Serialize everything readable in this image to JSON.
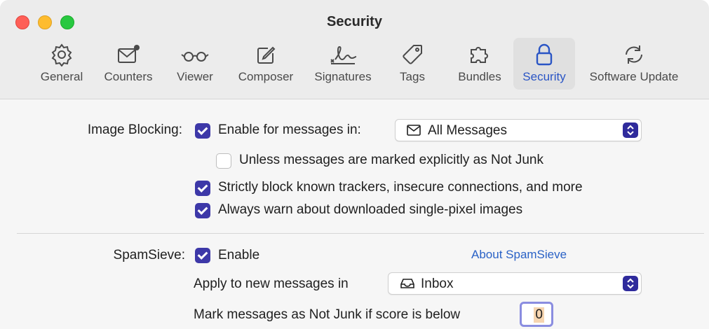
{
  "window": {
    "title": "Security"
  },
  "tabs": [
    {
      "label": "General",
      "icon": "gear-icon"
    },
    {
      "label": "Counters",
      "icon": "envelope-badge-icon"
    },
    {
      "label": "Viewer",
      "icon": "eyeglasses-icon"
    },
    {
      "label": "Composer",
      "icon": "compose-icon"
    },
    {
      "label": "Signatures",
      "icon": "signature-icon"
    },
    {
      "label": "Tags",
      "icon": "tag-icon"
    },
    {
      "label": "Bundles",
      "icon": "puzzle-icon"
    },
    {
      "label": "Security",
      "icon": "lock-icon",
      "active": true
    },
    {
      "label": "Software Update",
      "icon": "refresh-icon"
    }
  ],
  "image_blocking": {
    "section_label": "Image Blocking:",
    "enable_label": "Enable for messages in:",
    "enable_checked": true,
    "popup_value": "All Messages",
    "popup_icon": "envelope-icon",
    "unless_label": "Unless messages are marked explicitly as Not Junk",
    "unless_checked": false,
    "trackers_label": "Strictly block known trackers, insecure connections, and more",
    "trackers_checked": true,
    "pixel_label": "Always warn about downloaded single-pixel images",
    "pixel_checked": true
  },
  "spamsieve": {
    "section_label": "SpamSieve:",
    "enable_label": "Enable",
    "enable_checked": true,
    "about_link": "About SpamSieve",
    "apply_label": "Apply to new messages in",
    "apply_value": "Inbox",
    "apply_icon": "inbox-tray-icon",
    "score_label": "Mark messages as Not Junk if score is below",
    "score_value": "0"
  },
  "colors": {
    "accent": "#3d38a8",
    "link": "#2a62c6",
    "active_tab": "#2a55c5"
  }
}
